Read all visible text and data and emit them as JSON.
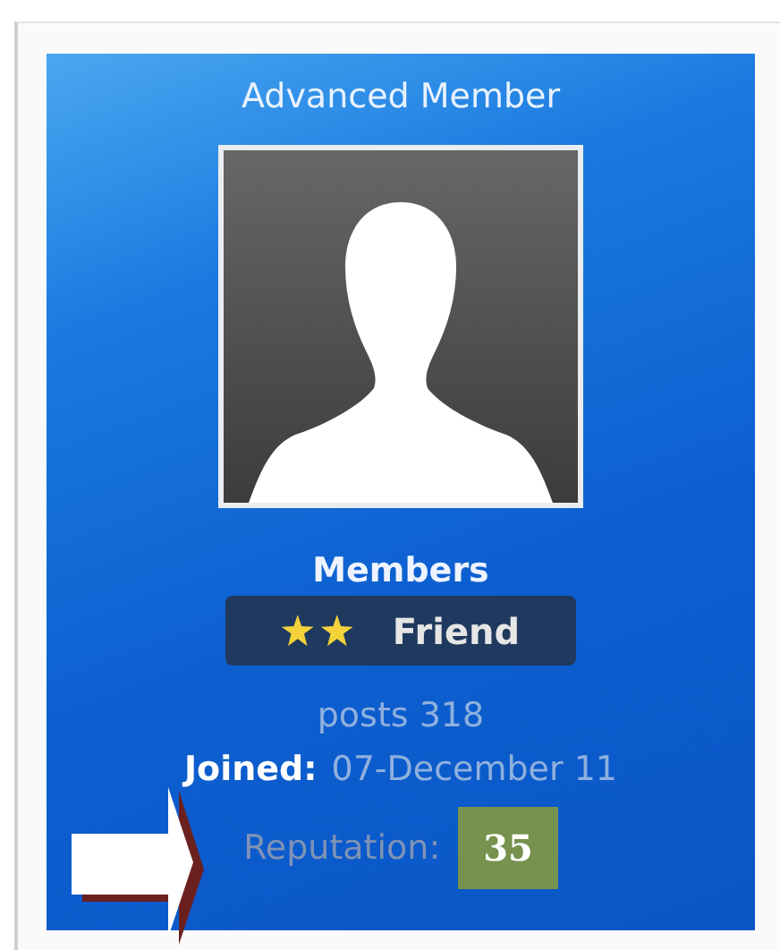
{
  "profile": {
    "title": "Advanced Member",
    "group": "Members",
    "rank": {
      "icons": [
        {
          "kind": "star"
        },
        {
          "kind": "star"
        }
      ],
      "label": "Friend"
    },
    "posts": "posts 318",
    "joined": {
      "label": "Joined:",
      "value": "07-December 11"
    },
    "reputation": {
      "label": "Reputation:",
      "value": "35"
    }
  },
  "annotation": {
    "kind": "arrow"
  }
}
